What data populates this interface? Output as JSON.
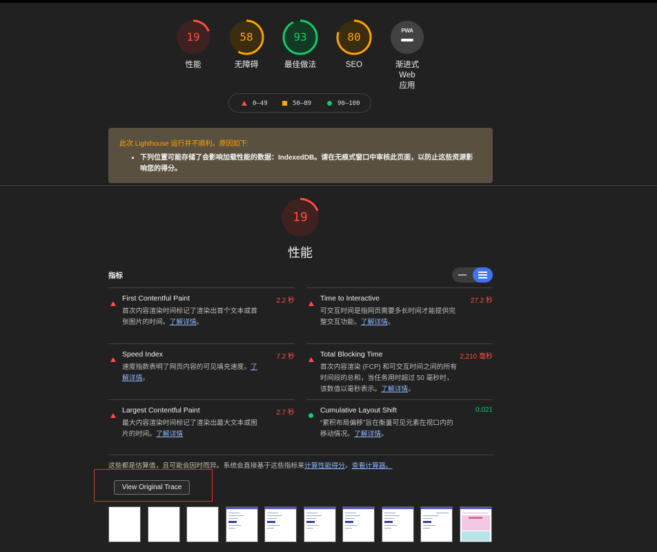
{
  "gauges": [
    {
      "score": "19",
      "label": "性能",
      "color": "#ff4e42",
      "track": "#3f2120",
      "fraction": 0.19
    },
    {
      "score": "58",
      "label": "无障碍",
      "color": "#ffa400",
      "track": "#3b2d10",
      "fraction": 0.58
    },
    {
      "score": "93",
      "label": "最佳做法",
      "color": "#0cce6b",
      "track": "#133a24",
      "fraction": 0.93
    },
    {
      "score": "80",
      "label": "SEO",
      "color": "#ffa400",
      "track": "#3b2d10",
      "fraction": 0.8
    }
  ],
  "pwa": {
    "badge_text": "PWA",
    "label_line1": "渐进式 Web",
    "label_line2": "应用"
  },
  "legend": {
    "fail": "0–49",
    "average": "50–89",
    "pass": "90–100"
  },
  "warning": {
    "title": "此次 Lighthouse 运行并不顺利。原因如下:",
    "item": "下列位置可能存储了会影响加载性能的数据：IndexedDB。请在无痕式窗口中审核此页面，以防止这些资源影响您的得分。"
  },
  "performance": {
    "score": "19",
    "title": "性能",
    "color": "#ff4e42",
    "fraction": 0.19
  },
  "metrics_header": "指标",
  "metrics": [
    {
      "title": "First Contentful Paint",
      "value": "2.2 秒",
      "status": "fail",
      "desc": "首次内容渲染时间标记了渲染出首个文本或首张图片的时间。",
      "link": "了解详情"
    },
    {
      "title": "Time to Interactive",
      "value": "27.2 秒",
      "status": "fail",
      "desc": "可交互时间是指网页需要多长时间才能提供完整交互功能。",
      "link": "了解详情"
    },
    {
      "title": "Speed Index",
      "value": "7.2 秒",
      "status": "fail",
      "desc": "速度指数表明了网页内容的可见填充速度。",
      "link": "了解详情"
    },
    {
      "title": "Total Blocking Time",
      "value": "2,210 毫秒",
      "status": "fail",
      "desc": "首次内容渲染 (FCP) 和可交互时间之间的所有时间段的总和，当任务用时超过 50 毫秒时，该数值以毫秒表示。",
      "link": "了解详情"
    },
    {
      "title": "Largest Contentful Paint",
      "value": "2.7 秒",
      "status": "fail",
      "desc": "最大内容渲染时间标记了渲染出最大文本或图片的时间。",
      "link": "了解详情"
    },
    {
      "title": "Cumulative Layout Shift",
      "value": "0.021",
      "status": "pass",
      "desc": "“累积布局偏移”旨在衡量可见元素在视口内的移动情况。",
      "link": "了解详情"
    }
  ],
  "footnote": {
    "text": "这些都是估算值，且可能会因时而异。系统会直接基于这些指标来",
    "link1": "计算性能得分",
    "sep": "。",
    "link2": "查看计算器。"
  },
  "trace_button": "View Original Trace"
}
